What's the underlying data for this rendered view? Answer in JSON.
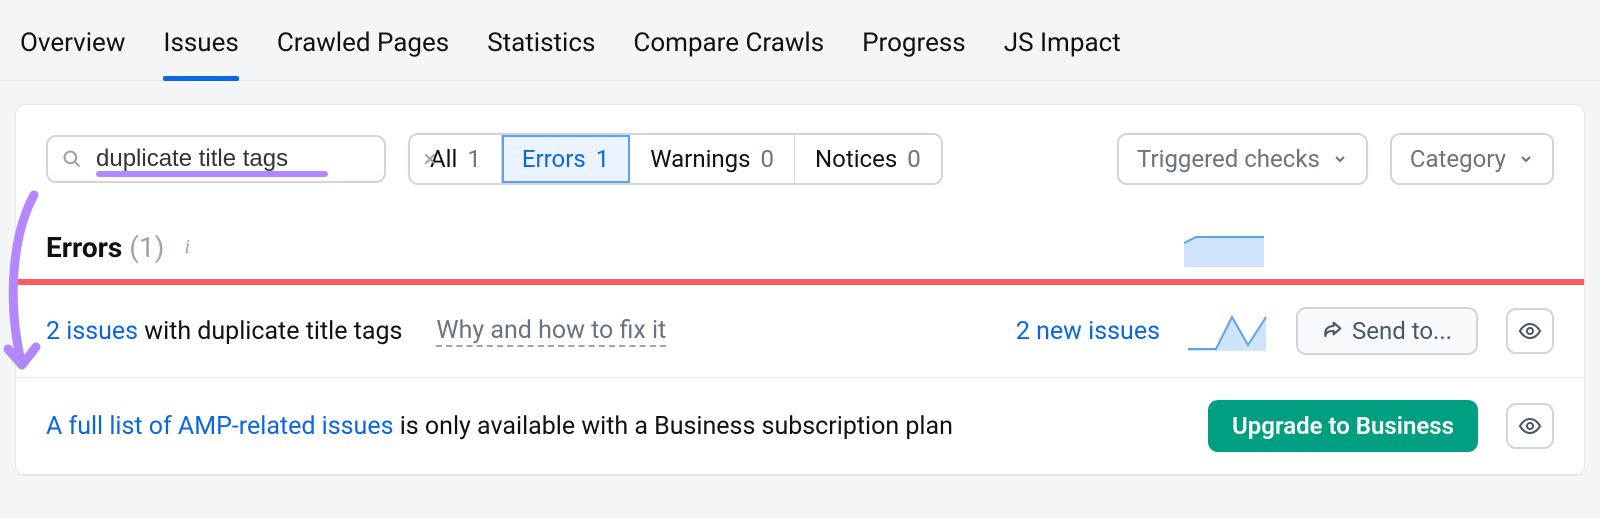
{
  "tabs": {
    "items": [
      "Overview",
      "Issues",
      "Crawled Pages",
      "Statistics",
      "Compare Crawls",
      "Progress",
      "JS Impact"
    ],
    "active_index": 1
  },
  "search": {
    "value": "duplicate title tags"
  },
  "filters": {
    "items": [
      {
        "label": "All",
        "count": "1"
      },
      {
        "label": "Errors",
        "count": "1"
      },
      {
        "label": "Warnings",
        "count": "0"
      },
      {
        "label": "Notices",
        "count": "0"
      }
    ],
    "active_index": 1
  },
  "dropdowns": {
    "triggered_checks": "Triggered checks",
    "category": "Category"
  },
  "section": {
    "title": "Errors",
    "count_display": "(1)"
  },
  "rows": {
    "issue": {
      "link_text": "2 issues",
      "text": " with duplicate title tags",
      "hint": "Why and how to fix it",
      "new_issues": "2 new issues",
      "send_to": "Send to..."
    },
    "amp": {
      "link_text": "A full list of AMP-related issues",
      "text": " is only available with a Business subscription plan",
      "upgrade": "Upgrade to Business"
    }
  },
  "chart_data": [
    {
      "type": "area",
      "title": "Errors trend (header sparkline)",
      "x": [
        0,
        1,
        2,
        3,
        4,
        5
      ],
      "values": [
        10,
        12,
        12,
        12,
        12,
        12
      ],
      "ylim": [
        0,
        15
      ],
      "legend": false,
      "xlabel": "",
      "ylabel": ""
    },
    {
      "type": "area",
      "title": "Duplicate title tags trend (row sparkline)",
      "x": [
        0,
        1,
        2,
        3,
        4,
        5
      ],
      "values": [
        0,
        0,
        0,
        2,
        0.3,
        2
      ],
      "ylim": [
        0,
        2
      ],
      "legend": false,
      "xlabel": "",
      "ylabel": ""
    }
  ]
}
